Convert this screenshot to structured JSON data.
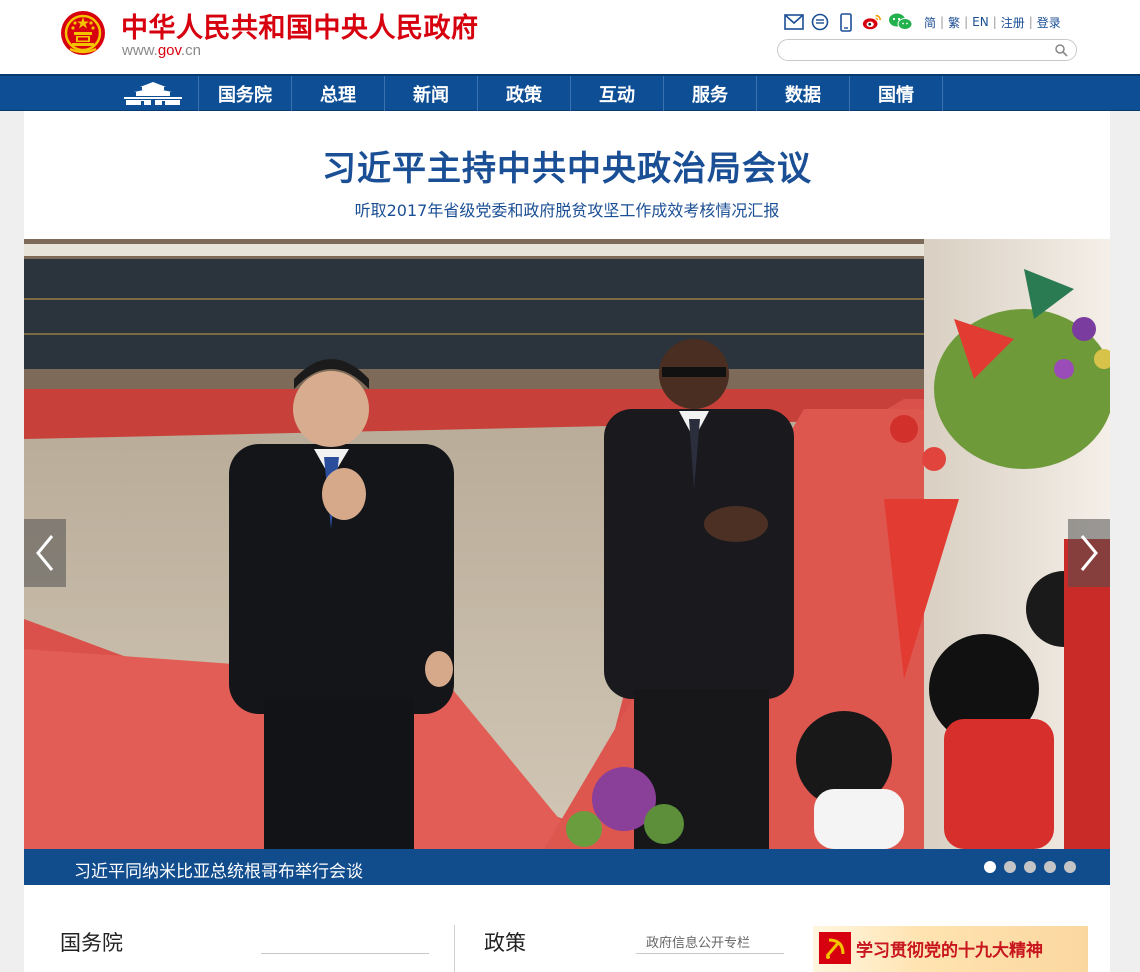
{
  "header": {
    "title": "中华人民共和国中央人民政府",
    "domain_prefix": "www.",
    "domain_main": "gov",
    "domain_suffix": ".cn",
    "toplinks": {
      "simplified": "简",
      "traditional": "繁",
      "english": "EN",
      "register": "注册",
      "login": "登录",
      "separator": "|"
    },
    "icons": [
      "mail-icon",
      "message-icon",
      "mobile-icon",
      "weibo-icon",
      "wechat-icon"
    ],
    "search": {
      "placeholder": "",
      "value": ""
    }
  },
  "nav": {
    "items": [
      {
        "label": "国务院"
      },
      {
        "label": "总理"
      },
      {
        "label": "新闻"
      },
      {
        "label": "政策"
      },
      {
        "label": "互动"
      },
      {
        "label": "服务"
      },
      {
        "label": "数据"
      },
      {
        "label": "国情"
      }
    ]
  },
  "headline": {
    "title": "习近平主持中共中央政治局会议",
    "subtitle": "听取2017年省级党委和政府脱贫攻坚工作成效考核情况汇报"
  },
  "carousel": {
    "caption": "习近平同纳米比亚总统根哥布举行会谈",
    "slide_count": 5,
    "active_index": 0
  },
  "sections": {
    "state_council": {
      "title": "国务院"
    },
    "policy": {
      "title": "政策",
      "link": "政府信息公开专栏"
    },
    "banner": {
      "text": "学习贯彻党的十九大精神"
    }
  },
  "colors": {
    "brand_red": "#d7000f",
    "nav_blue": "#0d4e94",
    "headline_blue": "#1b4f95",
    "caption_blue": "#114c8d"
  }
}
